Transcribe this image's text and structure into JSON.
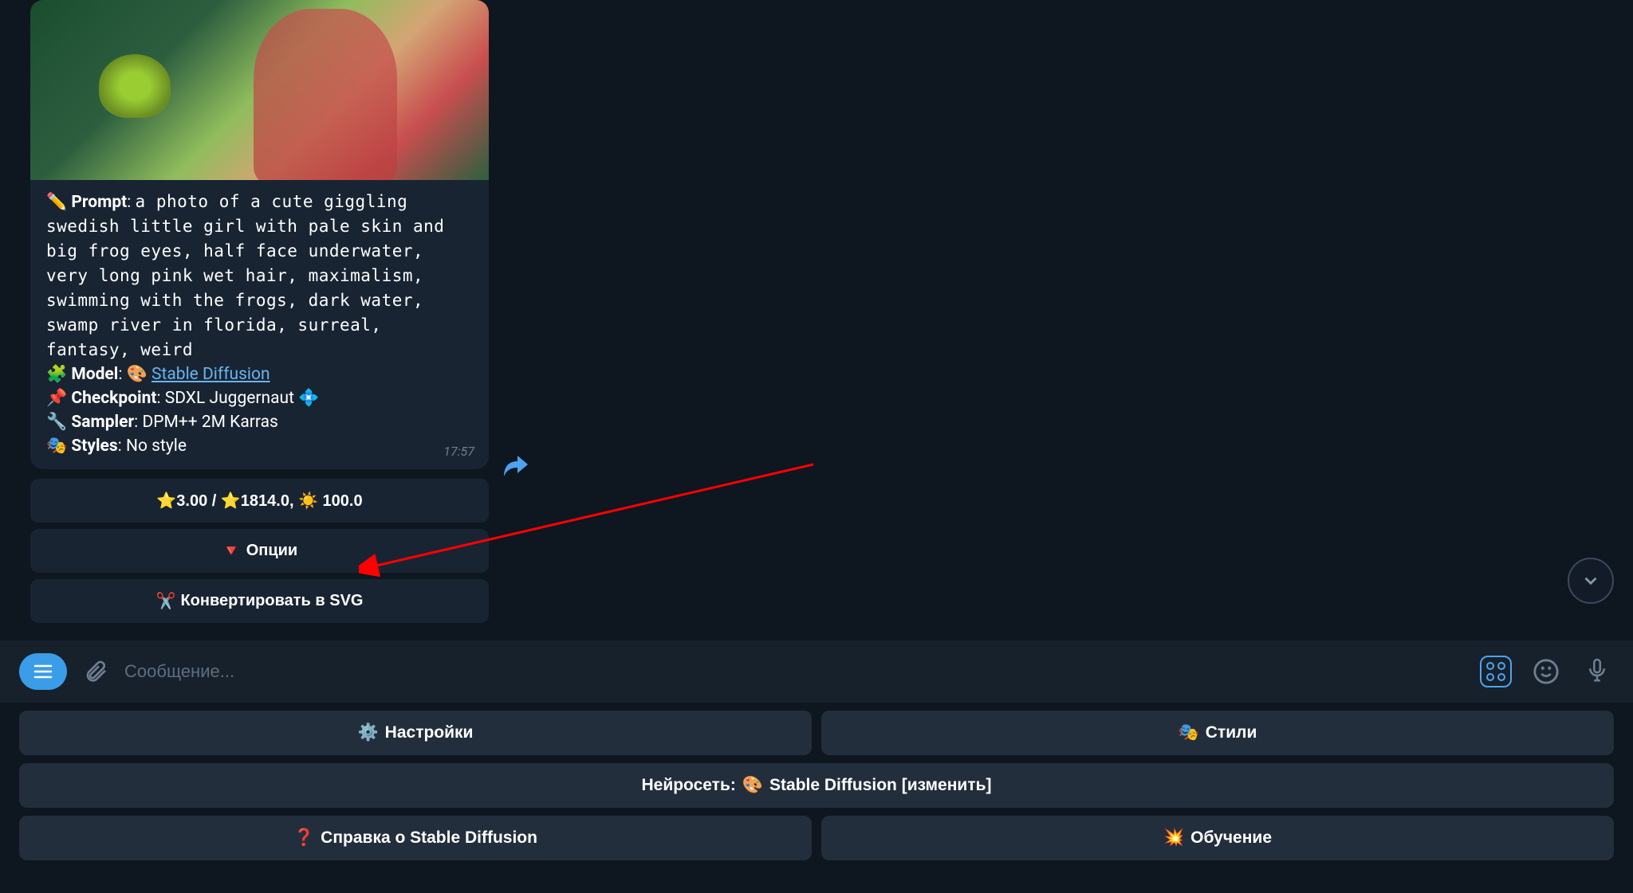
{
  "message": {
    "prompt_label": "Prompt",
    "prompt_text": "a photo of a cute giggling swedish little girl with pale skin and big frog eyes, half face underwater, very long pink wet hair, maximalism, swimming with the frogs, dark water, swamp river in florida, surreal, fantasy, weird",
    "model_label": "Model",
    "model_link": "Stable Diffusion",
    "checkpoint_label": "Checkpoint",
    "checkpoint_value": "SDXL Juggernaut",
    "sampler_label": "Sampler",
    "sampler_value": "DPM++ 2M Karras",
    "styles_label": "Styles",
    "styles_value": "No style",
    "timestamp": "17:57",
    "icons": {
      "pencil": "✏️",
      "puzzle": "🧩",
      "palette": "🎨",
      "pin": "📌",
      "diamond": "💠",
      "wrench": "🔧",
      "masks": "🎭"
    }
  },
  "action_buttons": {
    "stats": "⭐3.00 / ⭐1814.0, ☀️ 100.0",
    "options_icon": "🔻",
    "options_label": "Опции",
    "convert_icon": "✂️",
    "convert_label": "Конвертировать в SVG"
  },
  "input": {
    "placeholder": "Сообщение..."
  },
  "bottom_menu": {
    "settings_icon": "⚙️",
    "settings_label": "Настройки",
    "styles_icon": "🎭",
    "styles_label": "Стили",
    "nn_prefix": "Нейросеть:",
    "nn_icon": "🎨",
    "nn_value": "Stable Diffusion [изменить]",
    "help_icon": "❓",
    "help_label": "Справка о Stable Diffusion",
    "training_icon": "💥",
    "training_label": "Обучение"
  }
}
